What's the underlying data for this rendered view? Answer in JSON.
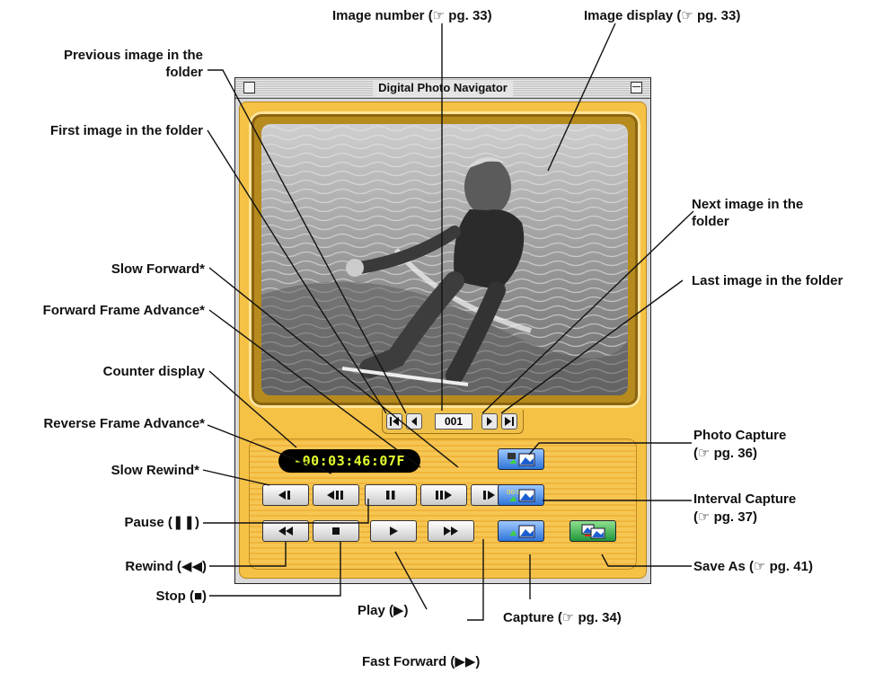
{
  "window": {
    "title": "Digital Photo Navigator",
    "counter": "-00:03:46:07F",
    "image_number": "001",
    "colors": {
      "panel": "#f5c246",
      "lcd_text": "#e4ff2f",
      "capture_blue": "#2e74d8",
      "save_green": "#21963a"
    }
  },
  "labels": {
    "image_number": "Image number (☞ pg. 33)",
    "image_display": "Image display (☞ pg. 33)",
    "previous_image": "Previous image in the folder",
    "first_image": "First image in the folder",
    "next_image": "Next image in the folder",
    "last_image": "Last image in the folder",
    "slow_forward": "Slow Forward*",
    "forward_frame_advance": "Forward Frame Advance*",
    "counter_display": "Counter display",
    "reverse_frame_advance": "Reverse Frame Advance*",
    "slow_rewind": "Slow Rewind*",
    "pause": "Pause (❚❚)",
    "rewind": "Rewind (◀◀)",
    "stop": "Stop (■)",
    "play": "Play (▶)",
    "fast_forward": "Fast Forward (▶▶)",
    "capture": "Capture (☞ pg. 34)",
    "photo_capture_1": "Photo Capture",
    "photo_capture_2": "(☞ pg. 36)",
    "interval_capture_1": "Interval Capture",
    "interval_capture_2": "(☞ pg. 37)",
    "save_as": "Save As (☞ pg. 41)"
  },
  "icons": {
    "transport": [
      "slow-rewind-icon",
      "reverse-frame-icon",
      "pause-icon",
      "forward-frame-icon",
      "slow-forward-icon",
      "rewind-icon",
      "stop-icon",
      "play-icon",
      "fast-forward-icon"
    ],
    "nav": [
      "first-image-icon",
      "previous-image-icon",
      "next-image-icon",
      "last-image-icon"
    ],
    "capture": [
      "photo-capture-icon",
      "interval-capture-icon",
      "capture-icon",
      "save-as-icon"
    ]
  }
}
